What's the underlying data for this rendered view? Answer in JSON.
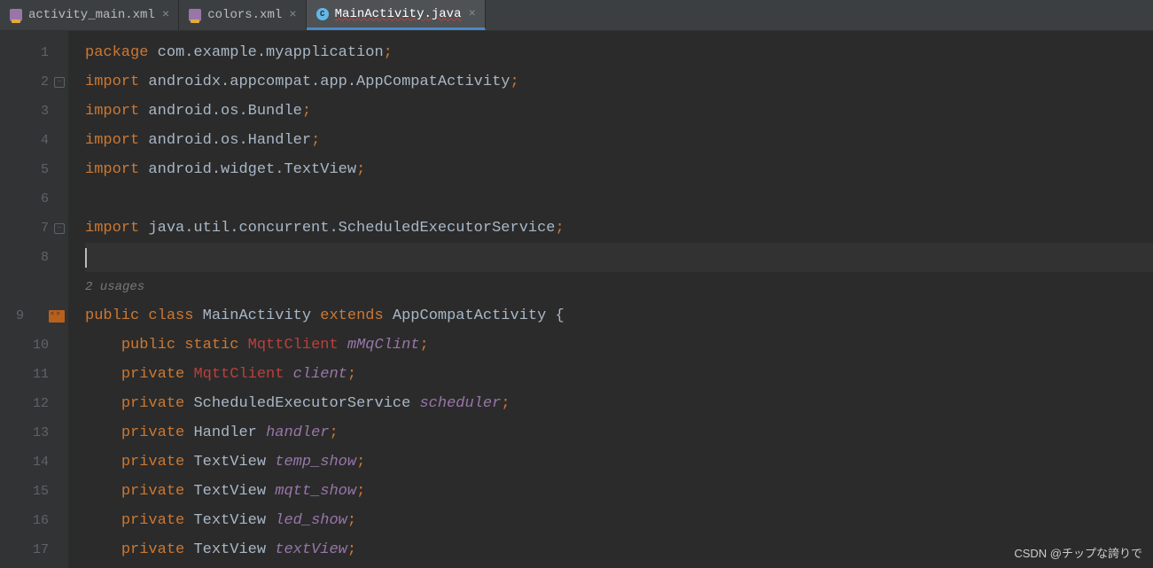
{
  "tabs": [
    {
      "label": "activity_main.xml",
      "type": "xml",
      "active": false
    },
    {
      "label": "colors.xml",
      "type": "xml",
      "active": false
    },
    {
      "label": "MainActivity.java",
      "type": "java",
      "active": true
    }
  ],
  "gutter": {
    "lines": [
      "1",
      "2",
      "3",
      "4",
      "5",
      "6",
      "7",
      "8",
      "",
      "9",
      "10",
      "11",
      "12",
      "13",
      "14",
      "15",
      "16",
      "17"
    ]
  },
  "code": {
    "l1": {
      "kw": "package",
      "sp": " ",
      "rest": "com.example.myapplication",
      "semi": ";"
    },
    "l2": {
      "kw": "import",
      "sp": " ",
      "rest": "androidx.appcompat.app.AppCompatActivity",
      "semi": ";"
    },
    "l3": {
      "kw": "import",
      "sp": " ",
      "rest": "android.os.Bundle",
      "semi": ";"
    },
    "l4": {
      "kw": "import",
      "sp": " ",
      "rest": "android.os.Handler",
      "semi": ";"
    },
    "l5": {
      "kw": "import",
      "sp": " ",
      "rest": "android.widget.TextView",
      "semi": ";"
    },
    "l7": {
      "kw": "import",
      "sp": " ",
      "rest": "java.util.concurrent.ScheduledExecutorService",
      "semi": ";"
    },
    "hint": "2 usages",
    "l9": {
      "kw1": "public",
      "sp1": " ",
      "kw2": "class",
      "sp2": " ",
      "cls": "MainActivity",
      "sp3": " ",
      "kw3": "extends",
      "sp4": " ",
      "sup": "AppCompatActivity",
      "brace": " {"
    },
    "l10": {
      "in": "    ",
      "kw1": "public",
      "sp1": " ",
      "kw2": "static",
      "sp2": " ",
      "type": "MqttClient",
      "sp3": " ",
      "field": "mMqClint",
      "semi": ";"
    },
    "l11": {
      "in": "    ",
      "kw": "private",
      "sp": " ",
      "type": "MqttClient",
      "sp2": " ",
      "field": "client",
      "semi": ";"
    },
    "l12": {
      "in": "    ",
      "kw": "private",
      "sp": " ",
      "type": "ScheduledExecutorService",
      "sp2": " ",
      "field": "scheduler",
      "semi": ";"
    },
    "l13": {
      "in": "    ",
      "kw": "private",
      "sp": " ",
      "type": "Handler",
      "sp2": " ",
      "field": "handler",
      "semi": ";"
    },
    "l14": {
      "in": "    ",
      "kw": "private",
      "sp": " ",
      "type": "TextView",
      "sp2": " ",
      "field": "temp_show",
      "semi": ";"
    },
    "l15": {
      "in": "    ",
      "kw": "private",
      "sp": " ",
      "type": "TextView",
      "sp2": " ",
      "field": "mqtt_show",
      "semi": ";"
    },
    "l16": {
      "in": "    ",
      "kw": "private",
      "sp": " ",
      "type": "TextView",
      "sp2": " ",
      "field": "led_show",
      "semi": ";"
    },
    "l17": {
      "in": "    ",
      "kw": "private",
      "sp": " ",
      "type": "TextView",
      "sp2": " ",
      "field": "textView",
      "semi": ";"
    }
  },
  "watermark": "CSDN @チップな誇りで"
}
